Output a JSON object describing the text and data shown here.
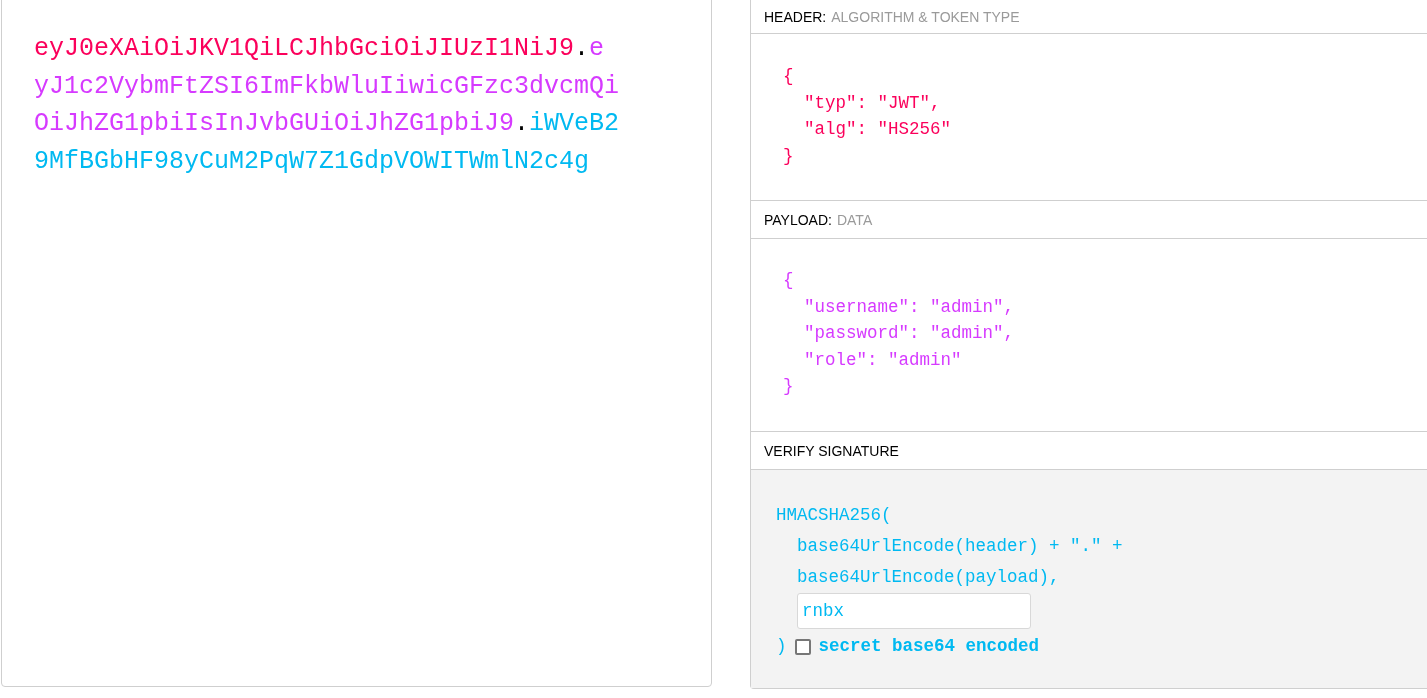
{
  "encoded_token": [
    {
      "kind": "header",
      "text": "eyJ0eXAiOiJKV1QiLCJhbGciOiJIUzI1NiJ9"
    },
    {
      "kind": "dot",
      "text": "."
    },
    {
      "kind": "payload",
      "text": "eyJ1c2VybmFtZSI6ImFkbWluIiwicGFzc3dvcmQiOiJhZG1pbiIsInJvbGUiOiJhZG1pbiJ9"
    },
    {
      "kind": "dot",
      "text": "."
    },
    {
      "kind": "signature",
      "text": "iWVeB29MfBGbHF98yCuM2PqW7Z1GdpVOWITWmlN2c4g"
    }
  ],
  "decoded": {
    "header": {
      "title": "HEADER:",
      "subtitle": "ALGORITHM & TOKEN TYPE",
      "open": "{",
      "entries": [
        "\"typ\": \"JWT\",",
        "\"alg\": \"HS256\""
      ],
      "close": "}"
    },
    "payload": {
      "title": "PAYLOAD:",
      "subtitle": "DATA",
      "open": "{",
      "entries": [
        "\"username\": \"admin\",",
        "\"password\": \"admin\",",
        "\"role\": \"admin\""
      ],
      "close": "}"
    },
    "verify_signature": {
      "title": "VERIFY SIGNATURE",
      "function": "HMACSHA256(",
      "arguments": [
        "base64UrlEncode(header) + \".\" +",
        "base64UrlEncode(payload),"
      ],
      "secret": {
        "value": "rnbx"
      },
      "close": ")",
      "base64_checkbox": {
        "label": "secret base64 encoded",
        "checked": false
      }
    }
  }
}
